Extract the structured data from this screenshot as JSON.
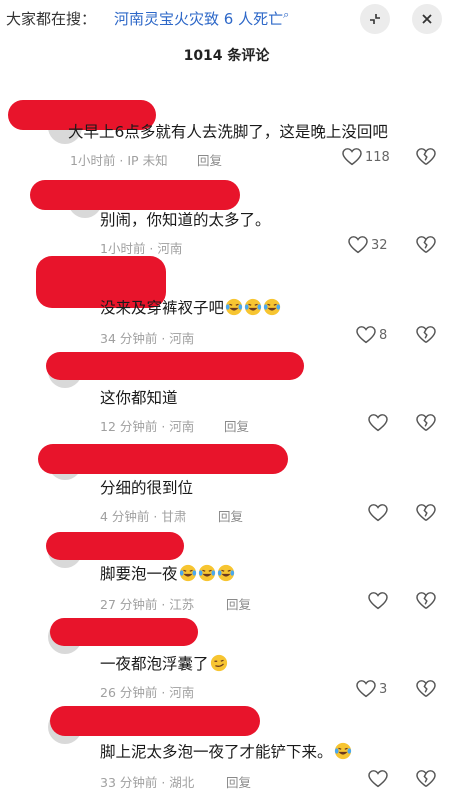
{
  "header": {
    "search_prefix": "大家都在搜：",
    "search_term": "河南灵宝火灾致 6 人死亡",
    "search_icon": "magnifier-icon",
    "collapse_icon": "collapse-icon",
    "close_icon": "close-icon"
  },
  "comment_count_title": "1014 条评论",
  "colors": {
    "accent": "#2e68c8",
    "redaction": "#e8142b",
    "meta": "#a0a0a0"
  },
  "comments": [
    {
      "text": "大早上6点多就有人去洗脚了，这是晚上没回吧",
      "emoji": "",
      "time": "1小时前 · IP 未知",
      "reply": "回复",
      "likes": "118"
    },
    {
      "text": "别闹，你知道的太多了。",
      "emoji": "",
      "time": "1小时前 · 河南",
      "reply": "回复",
      "likes": "32"
    },
    {
      "text": "没来及穿裤衩子吧",
      "emoji": "laughing-crying-emoji ×3",
      "time": "34 分钟前 · 河南",
      "reply": "回复",
      "likes": "8"
    },
    {
      "text": "这你都知道",
      "emoji": "",
      "time": "12 分钟前 · 河南",
      "reply": "回复",
      "likes": ""
    },
    {
      "text": "分细的很到位",
      "emoji": "",
      "time": "4 分钟前 · 甘肃",
      "reply": "回复",
      "likes": ""
    },
    {
      "text": "脚要泡一夜",
      "emoji": "laughing-crying-emoji ×3",
      "time": "27 分钟前 · 江苏",
      "reply": "回复",
      "likes": ""
    },
    {
      "text": "一夜都泡浮囊了",
      "emoji": "smirk-emoji",
      "time": "26 分钟前 · 河南",
      "reply": "回复",
      "likes": "3"
    },
    {
      "text": "脚上泥太多泡一夜了才能铲下来。",
      "emoji": "laughing-crying-emoji",
      "time": "33 分钟前 · 湖北",
      "reply": "回复",
      "likes": ""
    }
  ]
}
